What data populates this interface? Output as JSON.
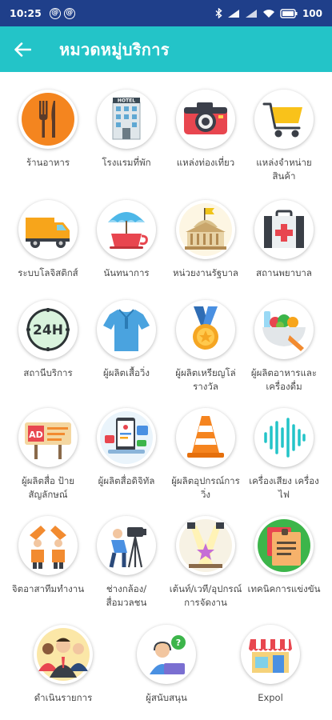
{
  "status_bar": {
    "time": "10:25",
    "battery_text": "100"
  },
  "app_bar": {
    "title": "หมวดหมู่บริการ"
  },
  "colors": {
    "status_bar_bg": "#1f3f8a",
    "app_bar_bg": "#23c4c8",
    "label_text": "#4a4a4a"
  },
  "categories": [
    {
      "label": "ร้านอาหาร",
      "icon": "restaurant-icon"
    },
    {
      "label": "โรงแรมที่พัก",
      "icon": "hotel-icon"
    },
    {
      "label": "แหล่งท่องเที่ยว",
      "icon": "camera-icon"
    },
    {
      "label": "แหล่งจำหน่ายสินค้า",
      "icon": "shopping-cart-icon"
    },
    {
      "label": "ระบบโลจิสติกส์",
      "icon": "truck-icon"
    },
    {
      "label": "นันทนาการ",
      "icon": "beach-cup-icon"
    },
    {
      "label": "หน่วยงานรัฐบาล",
      "icon": "government-building-icon"
    },
    {
      "label": "สถานพยาบาล",
      "icon": "first-aid-kit-icon"
    },
    {
      "label": "สถานีบริการ",
      "icon": "24h-service-icon"
    },
    {
      "label": "ผู้ผลิตเสื้อวิ่ง",
      "icon": "shirt-icon"
    },
    {
      "label": "ผู้ผลิตเหรียญโล่รางวัล",
      "icon": "medal-icon"
    },
    {
      "label": "ผู้ผลิตอาหารและเครื่องดื่ม",
      "icon": "food-bowl-icon"
    },
    {
      "label": "ผู้ผลิตสื่อ ป้ายสัญลักษณ์",
      "icon": "ad-sign-icon"
    },
    {
      "label": "ผู้ผลิตสื่อดิจิทัล",
      "icon": "digital-media-icon"
    },
    {
      "label": "ผู้ผลิตอุปกรณ์การวิ่ง",
      "icon": "traffic-cone-icon"
    },
    {
      "label": "เครื่องเสียง เครื่องไฟ",
      "icon": "sound-wave-icon"
    },
    {
      "label": "จิตอาสาทีมทำงาน",
      "icon": "volunteer-team-icon"
    },
    {
      "label": "ช่างกล้อง/สื่อมวลชน",
      "icon": "cameraman-icon"
    },
    {
      "label": "เต้นท์/เวที/อุปกรณ์การจัดงาน",
      "icon": "stage-lights-icon"
    },
    {
      "label": "เทคนิคการแข่งขัน",
      "icon": "notes-icon"
    }
  ],
  "bottom_categories": [
    {
      "label": "ดำเนินรายการ",
      "icon": "team-people-icon"
    },
    {
      "label": "ผู้สนับสนุน",
      "icon": "support-agent-icon"
    },
    {
      "label": "Expol",
      "icon": "storefront-icon"
    }
  ]
}
